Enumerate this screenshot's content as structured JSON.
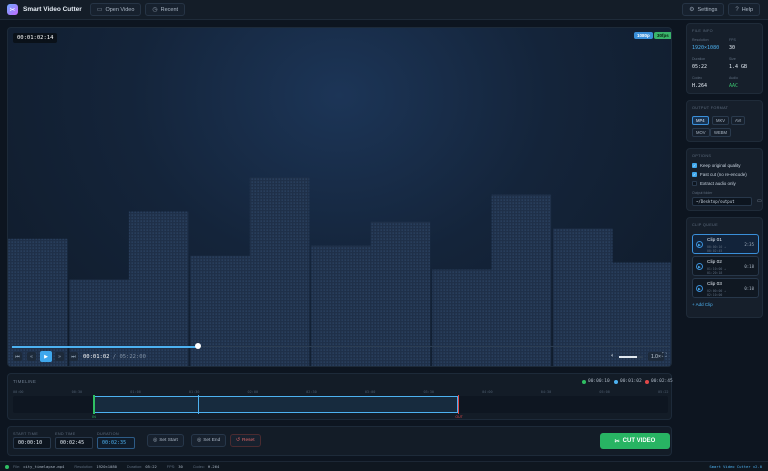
{
  "app": {
    "title": "Smart Video Cutter",
    "logo_icon": "scissors-icon"
  },
  "toolbar": {
    "open_label": "Open Video",
    "recent_label": "Recent",
    "settings_label": "Settings",
    "help_label": "Help"
  },
  "player": {
    "timecode": "00:01:02:14",
    "badge_res": "1080p",
    "badge_fps": "30fps",
    "current": "00:01:02",
    "sep": " / ",
    "total": "05:22:00",
    "progress_fraction": 0.283,
    "volume_fraction": 0.75,
    "speed": "1.0×",
    "bars": [
      0.38,
      0.26,
      0.46,
      0.33,
      0.56,
      0.36,
      0.43,
      0.29,
      0.51,
      0.41,
      0.31
    ]
  },
  "timeline": {
    "title": "TIMELINE",
    "legend": [
      {
        "label": "00:00:10",
        "color": "#2fbf63"
      },
      {
        "label": "00:01:02",
        "color": "#4db1f0"
      },
      {
        "label": "00:02:45",
        "color": "#e04848"
      }
    ],
    "ticks": [
      "00:00",
      "00:30",
      "01:00",
      "01:30",
      "02:00",
      "02:30",
      "03:00",
      "03:30",
      "04:00",
      "04:30",
      "05:00",
      "05:22"
    ],
    "start_fraction": 0.124,
    "head_fraction": 0.283,
    "end_fraction": 0.68,
    "start_mark": "IN",
    "end_mark": "OUT"
  },
  "cut": {
    "start_label": "START TIME",
    "start_value": "00:00:10",
    "end_label": "END TIME",
    "end_value": "00:02:45",
    "duration_label": "DURATION",
    "duration_value": "00:02:35",
    "set_start": "Set Start",
    "set_end": "Set End",
    "reset": "Reset",
    "cut_label": "CUT VIDEO"
  },
  "info": {
    "title": "FILE INFO",
    "items": [
      {
        "label": "Resolution",
        "value": "1920×1080",
        "color": "#4db1f0"
      },
      {
        "label": "FPS",
        "value": "30",
        "color": "#e6edf5"
      },
      {
        "label": "Duration",
        "value": "05:22",
        "color": "#e6edf5"
      },
      {
        "label": "Size",
        "value": "1.4 GB",
        "color": "#e6edf5"
      },
      {
        "label": "Codec",
        "value": "H.264",
        "color": "#e6edf5"
      },
      {
        "label": "Audio",
        "value": "AAC",
        "color": "#39c06e"
      }
    ]
  },
  "formats": {
    "title": "OUTPUT FORMAT",
    "items": [
      "MP4",
      "MKV",
      "AVI",
      "MOV",
      "WEBM"
    ],
    "selected": 0
  },
  "options": {
    "title": "OPTIONS",
    "items": [
      {
        "label": "Keep original quality",
        "checked": true
      },
      {
        "label": "Fast cut (no re-encode)",
        "checked": true
      },
      {
        "label": "Extract audio only",
        "checked": false
      }
    ],
    "output_label": "Output folder",
    "output_value": "~/Desktop/output",
    "folder_icon": "folder-icon"
  },
  "clips": {
    "title": "CLIP QUEUE",
    "items": [
      {
        "name": "Clip 01",
        "range": "00:00:10 → 00:02:45",
        "dur": "2:35",
        "active": true
      },
      {
        "name": "Clip 02",
        "range": "01:10:00 → 01:20:18",
        "dur": "0:18",
        "active": false
      },
      {
        "name": "Clip 03",
        "range": "02:00:00 → 02:10:00",
        "dur": "0:10",
        "active": false
      }
    ],
    "add_label": "+ Add Clip"
  },
  "status": {
    "file_label": "File:",
    "file_value": "city_timelapse.mp4",
    "res_label": "Resolution:",
    "res_value": "1920×1080",
    "dur_label": "Duration:",
    "dur_value": "05:22",
    "fps_label": "FPS:",
    "fps_value": "30",
    "codec_label": "Codec:",
    "codec_value": "H.264",
    "version": "Smart Video Cutter v2.0"
  }
}
